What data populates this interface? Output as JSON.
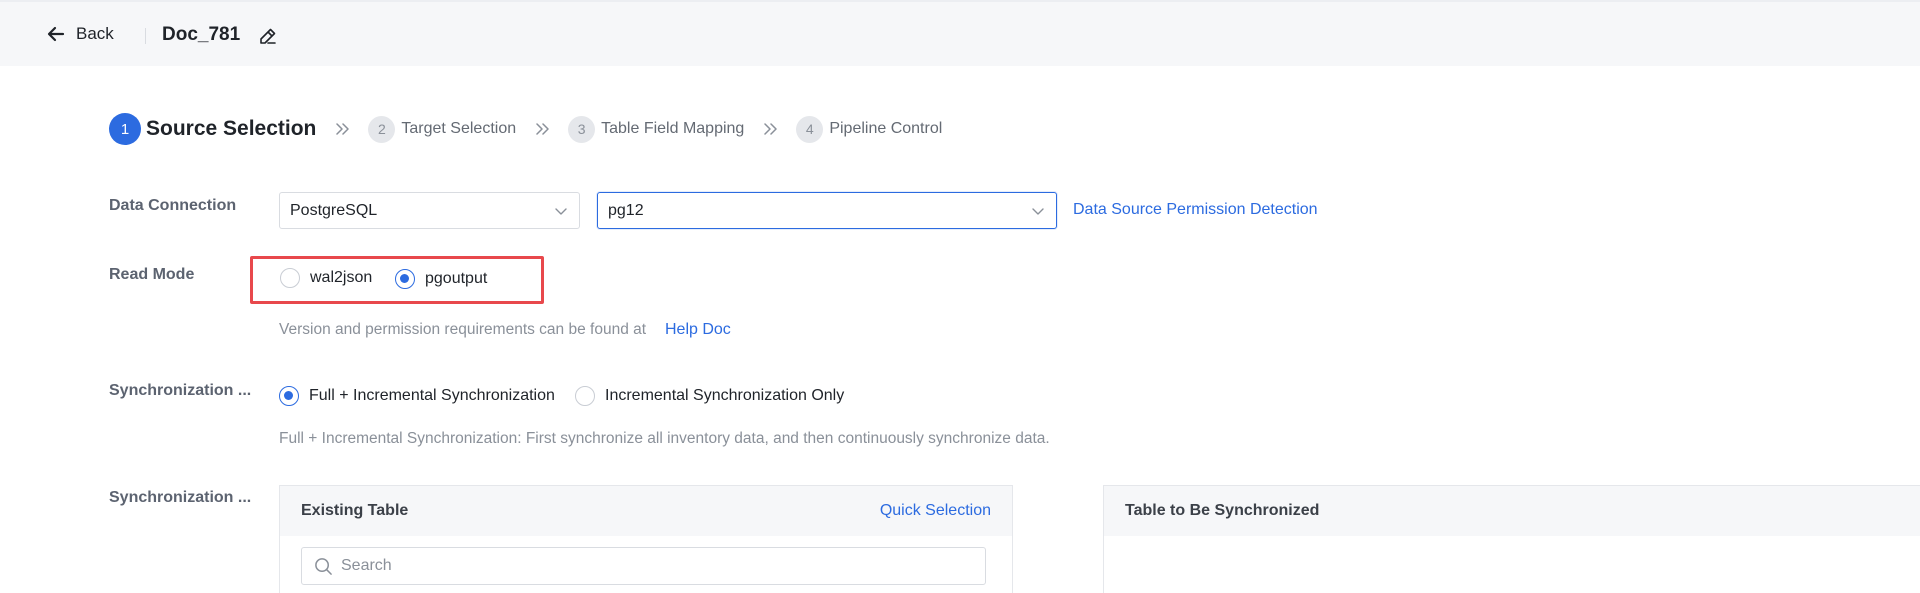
{
  "header": {
    "back_label": "Back",
    "doc_title": "Doc_781"
  },
  "steps": [
    {
      "num": "1",
      "label": "Source Selection",
      "active": true
    },
    {
      "num": "2",
      "label": "Target Selection",
      "active": false
    },
    {
      "num": "3",
      "label": "Table Field Mapping",
      "active": false
    },
    {
      "num": "4",
      "label": "Pipeline Control",
      "active": false
    }
  ],
  "data_connection": {
    "label": "Data Connection",
    "type_value": "PostgreSQL",
    "instance_value": "pg12",
    "permission_link": "Data Source Permission Detection"
  },
  "read_mode": {
    "label": "Read Mode",
    "options": [
      "wal2json",
      "pgoutput"
    ],
    "selected": "pgoutput",
    "hint": "Version and permission requirements can be found at",
    "help_link": "Help Doc"
  },
  "sync_mode": {
    "label": "Synchronization ...",
    "options": [
      "Full + Incremental Synchronization",
      "Incremental Synchronization Only"
    ],
    "selected": "Full + Incremental Synchronization",
    "hint": "Full + Incremental Synchronization: First synchronize all inventory data, and then continuously synchronize data."
  },
  "sync_objects": {
    "label": "Synchronization ...",
    "existing_title": "Existing Table",
    "quick_selection": "Quick Selection",
    "search_placeholder": "Search",
    "target_title": "Table to Be Synchronized"
  },
  "colors": {
    "accent": "#2c6be0",
    "highlight": "#e8484c"
  }
}
